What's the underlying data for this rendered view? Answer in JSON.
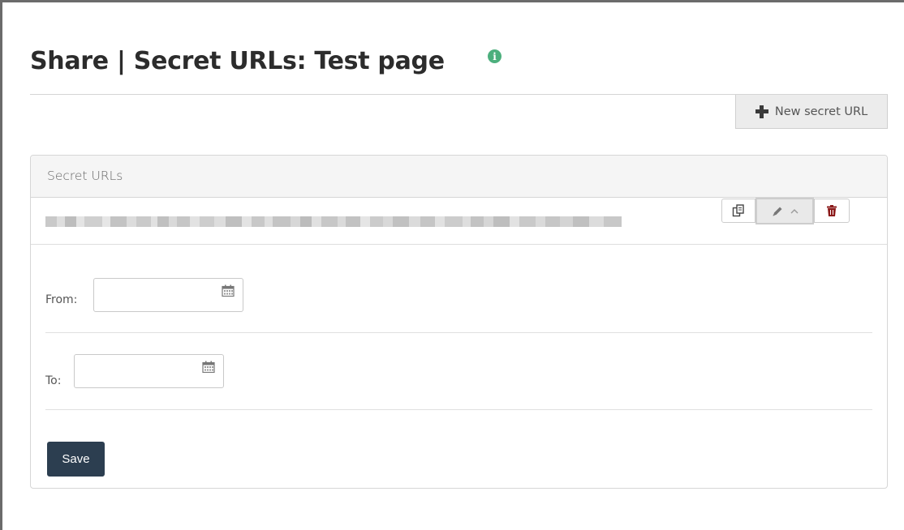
{
  "header": {
    "title": "Share | Secret URLs: Test page",
    "info_icon": "info-circle-icon",
    "info_color": "#4caf7d"
  },
  "toolbar": {
    "new_secret_url_label": "New secret URL",
    "new_icon": "plus-icon"
  },
  "panel": {
    "heading": "Secret URLs",
    "url_row": {
      "url_display": "blurred (redacted URL)",
      "actions": [
        {
          "name": "copy",
          "icon": "copy-icon"
        },
        {
          "name": "edit",
          "icon": "pencil-icon",
          "expanded_icon": "chevron-up-icon",
          "active": true
        },
        {
          "name": "delete",
          "icon": "trash-icon",
          "color": "#8b1a1a"
        }
      ]
    },
    "form": {
      "from_label": "From:",
      "from_value": "",
      "to_label": "To:",
      "to_value": "",
      "save_label": "Save"
    }
  },
  "colors": {
    "primary_button": "#2c3e50",
    "danger_icon": "#8b1a1a"
  }
}
